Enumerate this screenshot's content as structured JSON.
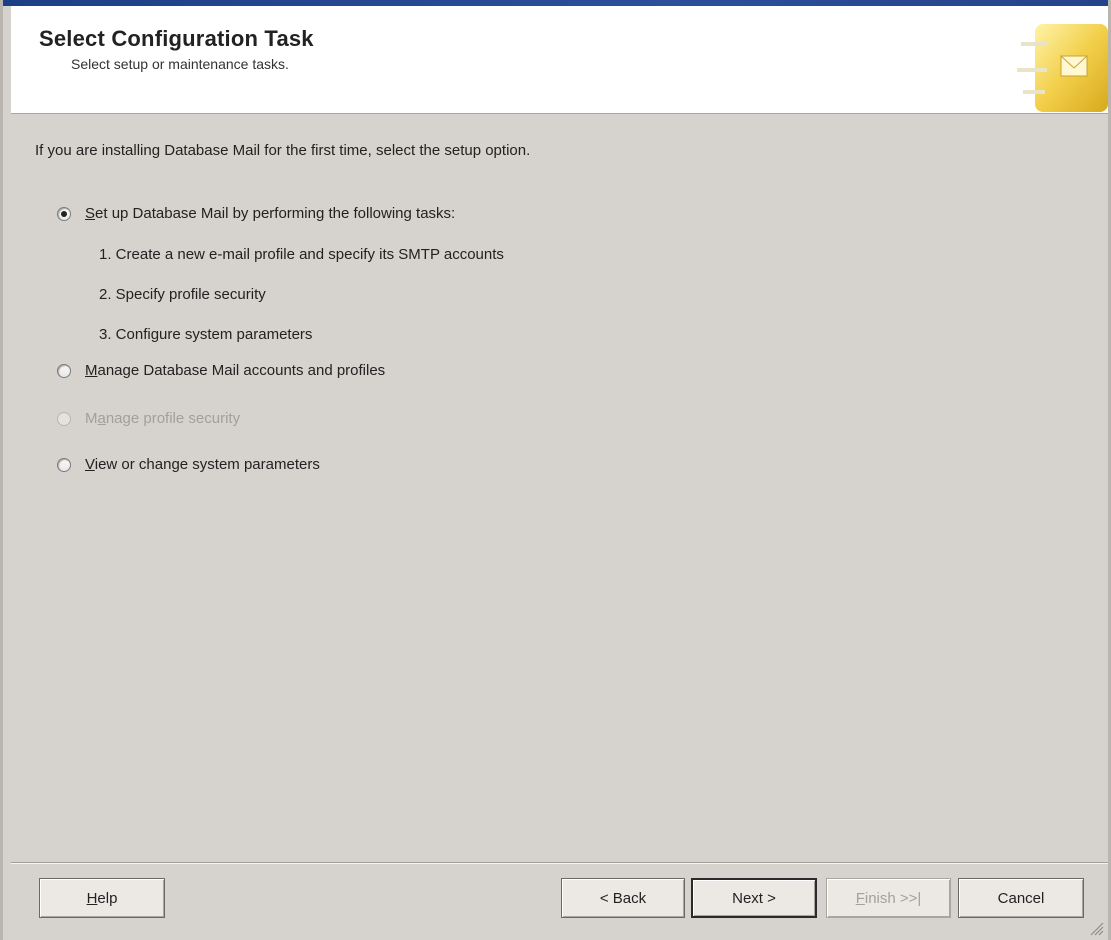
{
  "header": {
    "title": "Select Configuration Task",
    "subtitle": "Select setup or maintenance tasks."
  },
  "intro_text": "If you are installing Database Mail for the first time, select the setup option.",
  "options": [
    {
      "label_prefix": "",
      "mnemonic": "S",
      "label_rest": "et up Database Mail by performing the following tasks:",
      "selected": true,
      "enabled": true
    },
    {
      "label_prefix": "",
      "mnemonic": "M",
      "label_rest": "anage Database Mail accounts and profiles",
      "selected": false,
      "enabled": true
    },
    {
      "label_prefix": "M",
      "mnemonic": "a",
      "label_rest": "nage profile security",
      "selected": false,
      "enabled": false
    },
    {
      "label_prefix": "",
      "mnemonic": "V",
      "label_rest": "iew or change system parameters",
      "selected": false,
      "enabled": true
    }
  ],
  "setup_steps": [
    "1. Create a new e-mail profile and specify its SMTP accounts",
    "2. Specify profile security",
    "3. Configure system parameters"
  ],
  "buttons": {
    "help": {
      "mnemonic": "H",
      "rest": "elp"
    },
    "back": "< Back",
    "next": "Next >",
    "finish": {
      "mnemonic": "F",
      "rest": "inish >>|"
    },
    "cancel": "Cancel"
  },
  "colors": {
    "dialog_bg": "#d6d3ce",
    "header_bg": "#ffffff",
    "title_strip": "#1d3f86",
    "disabled_text": "#a3a09b"
  }
}
